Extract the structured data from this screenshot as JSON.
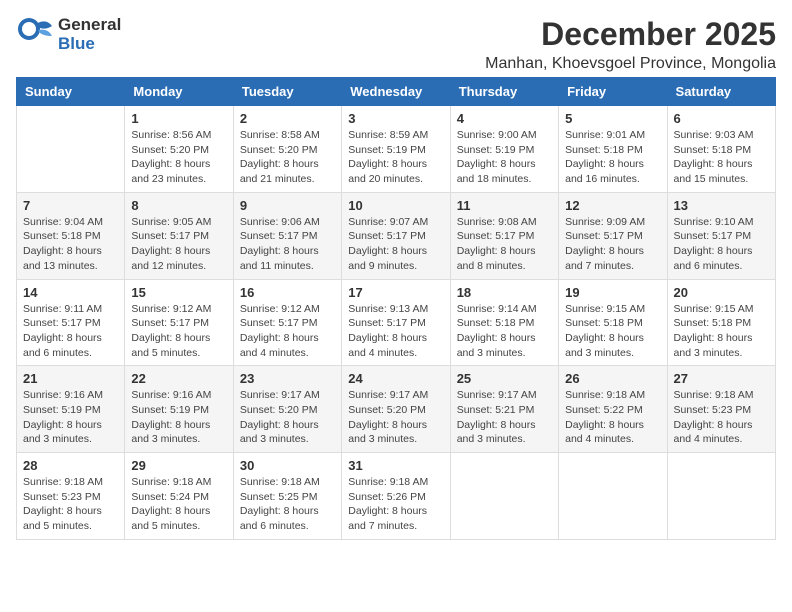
{
  "logo": {
    "general": "General",
    "blue": "Blue"
  },
  "title": "December 2025",
  "subtitle": "Manhan, Khoevsgoel Province, Mongolia",
  "weekdays": [
    "Sunday",
    "Monday",
    "Tuesday",
    "Wednesday",
    "Thursday",
    "Friday",
    "Saturday"
  ],
  "weeks": [
    [
      {
        "day": "",
        "sunrise": "",
        "sunset": "",
        "daylight": ""
      },
      {
        "day": "1",
        "sunrise": "Sunrise: 8:56 AM",
        "sunset": "Sunset: 5:20 PM",
        "daylight": "Daylight: 8 hours and 23 minutes."
      },
      {
        "day": "2",
        "sunrise": "Sunrise: 8:58 AM",
        "sunset": "Sunset: 5:20 PM",
        "daylight": "Daylight: 8 hours and 21 minutes."
      },
      {
        "day": "3",
        "sunrise": "Sunrise: 8:59 AM",
        "sunset": "Sunset: 5:19 PM",
        "daylight": "Daylight: 8 hours and 20 minutes."
      },
      {
        "day": "4",
        "sunrise": "Sunrise: 9:00 AM",
        "sunset": "Sunset: 5:19 PM",
        "daylight": "Daylight: 8 hours and 18 minutes."
      },
      {
        "day": "5",
        "sunrise": "Sunrise: 9:01 AM",
        "sunset": "Sunset: 5:18 PM",
        "daylight": "Daylight: 8 hours and 16 minutes."
      },
      {
        "day": "6",
        "sunrise": "Sunrise: 9:03 AM",
        "sunset": "Sunset: 5:18 PM",
        "daylight": "Daylight: 8 hours and 15 minutes."
      }
    ],
    [
      {
        "day": "7",
        "sunrise": "Sunrise: 9:04 AM",
        "sunset": "Sunset: 5:18 PM",
        "daylight": "Daylight: 8 hours and 13 minutes."
      },
      {
        "day": "8",
        "sunrise": "Sunrise: 9:05 AM",
        "sunset": "Sunset: 5:17 PM",
        "daylight": "Daylight: 8 hours and 12 minutes."
      },
      {
        "day": "9",
        "sunrise": "Sunrise: 9:06 AM",
        "sunset": "Sunset: 5:17 PM",
        "daylight": "Daylight: 8 hours and 11 minutes."
      },
      {
        "day": "10",
        "sunrise": "Sunrise: 9:07 AM",
        "sunset": "Sunset: 5:17 PM",
        "daylight": "Daylight: 8 hours and 9 minutes."
      },
      {
        "day": "11",
        "sunrise": "Sunrise: 9:08 AM",
        "sunset": "Sunset: 5:17 PM",
        "daylight": "Daylight: 8 hours and 8 minutes."
      },
      {
        "day": "12",
        "sunrise": "Sunrise: 9:09 AM",
        "sunset": "Sunset: 5:17 PM",
        "daylight": "Daylight: 8 hours and 7 minutes."
      },
      {
        "day": "13",
        "sunrise": "Sunrise: 9:10 AM",
        "sunset": "Sunset: 5:17 PM",
        "daylight": "Daylight: 8 hours and 6 minutes."
      }
    ],
    [
      {
        "day": "14",
        "sunrise": "Sunrise: 9:11 AM",
        "sunset": "Sunset: 5:17 PM",
        "daylight": "Daylight: 8 hours and 6 minutes."
      },
      {
        "day": "15",
        "sunrise": "Sunrise: 9:12 AM",
        "sunset": "Sunset: 5:17 PM",
        "daylight": "Daylight: 8 hours and 5 minutes."
      },
      {
        "day": "16",
        "sunrise": "Sunrise: 9:12 AM",
        "sunset": "Sunset: 5:17 PM",
        "daylight": "Daylight: 8 hours and 4 minutes."
      },
      {
        "day": "17",
        "sunrise": "Sunrise: 9:13 AM",
        "sunset": "Sunset: 5:17 PM",
        "daylight": "Daylight: 8 hours and 4 minutes."
      },
      {
        "day": "18",
        "sunrise": "Sunrise: 9:14 AM",
        "sunset": "Sunset: 5:18 PM",
        "daylight": "Daylight: 8 hours and 3 minutes."
      },
      {
        "day": "19",
        "sunrise": "Sunrise: 9:15 AM",
        "sunset": "Sunset: 5:18 PM",
        "daylight": "Daylight: 8 hours and 3 minutes."
      },
      {
        "day": "20",
        "sunrise": "Sunrise: 9:15 AM",
        "sunset": "Sunset: 5:18 PM",
        "daylight": "Daylight: 8 hours and 3 minutes."
      }
    ],
    [
      {
        "day": "21",
        "sunrise": "Sunrise: 9:16 AM",
        "sunset": "Sunset: 5:19 PM",
        "daylight": "Daylight: 8 hours and 3 minutes."
      },
      {
        "day": "22",
        "sunrise": "Sunrise: 9:16 AM",
        "sunset": "Sunset: 5:19 PM",
        "daylight": "Daylight: 8 hours and 3 minutes."
      },
      {
        "day": "23",
        "sunrise": "Sunrise: 9:17 AM",
        "sunset": "Sunset: 5:20 PM",
        "daylight": "Daylight: 8 hours and 3 minutes."
      },
      {
        "day": "24",
        "sunrise": "Sunrise: 9:17 AM",
        "sunset": "Sunset: 5:20 PM",
        "daylight": "Daylight: 8 hours and 3 minutes."
      },
      {
        "day": "25",
        "sunrise": "Sunrise: 9:17 AM",
        "sunset": "Sunset: 5:21 PM",
        "daylight": "Daylight: 8 hours and 3 minutes."
      },
      {
        "day": "26",
        "sunrise": "Sunrise: 9:18 AM",
        "sunset": "Sunset: 5:22 PM",
        "daylight": "Daylight: 8 hours and 4 minutes."
      },
      {
        "day": "27",
        "sunrise": "Sunrise: 9:18 AM",
        "sunset": "Sunset: 5:23 PM",
        "daylight": "Daylight: 8 hours and 4 minutes."
      }
    ],
    [
      {
        "day": "28",
        "sunrise": "Sunrise: 9:18 AM",
        "sunset": "Sunset: 5:23 PM",
        "daylight": "Daylight: 8 hours and 5 minutes."
      },
      {
        "day": "29",
        "sunrise": "Sunrise: 9:18 AM",
        "sunset": "Sunset: 5:24 PM",
        "daylight": "Daylight: 8 hours and 5 minutes."
      },
      {
        "day": "30",
        "sunrise": "Sunrise: 9:18 AM",
        "sunset": "Sunset: 5:25 PM",
        "daylight": "Daylight: 8 hours and 6 minutes."
      },
      {
        "day": "31",
        "sunrise": "Sunrise: 9:18 AM",
        "sunset": "Sunset: 5:26 PM",
        "daylight": "Daylight: 8 hours and 7 minutes."
      },
      {
        "day": "",
        "sunrise": "",
        "sunset": "",
        "daylight": ""
      },
      {
        "day": "",
        "sunrise": "",
        "sunset": "",
        "daylight": ""
      },
      {
        "day": "",
        "sunrise": "",
        "sunset": "",
        "daylight": ""
      }
    ]
  ]
}
